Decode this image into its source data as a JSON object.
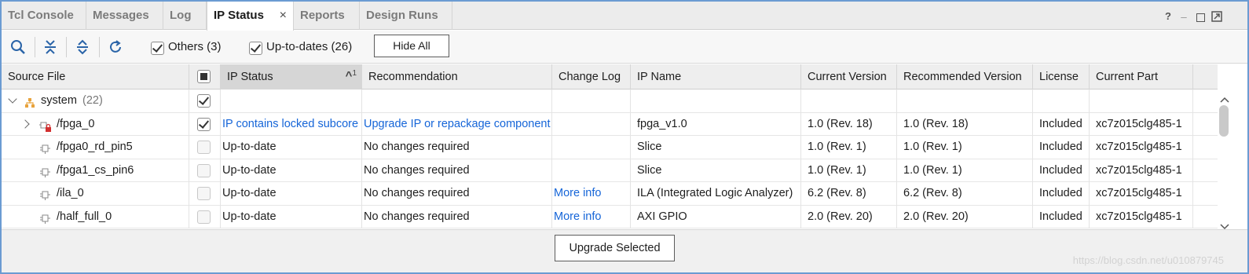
{
  "tabs": [
    {
      "label": "Tcl Console",
      "active": false
    },
    {
      "label": "Messages",
      "active": false
    },
    {
      "label": "Log",
      "active": false
    },
    {
      "label": "IP Status",
      "active": true
    },
    {
      "label": "Reports",
      "active": false
    },
    {
      "label": "Design Runs",
      "active": false
    }
  ],
  "tab_close_glyph": "×",
  "window_controls": {
    "help": "?",
    "minimize": "_"
  },
  "toolbar": {
    "others_label": "Others (3)",
    "others_checked": true,
    "uptodates_label": "Up-to-dates (26)",
    "uptodates_checked": true,
    "hide_all_label": "Hide All",
    "icons": [
      "search-icon",
      "collapse-all-icon",
      "expand-all-icon",
      "refresh-icon"
    ]
  },
  "table": {
    "columns": [
      "Source File",
      "",
      "IP Status",
      "Recommendation",
      "Change Log",
      "IP Name",
      "Current Version",
      "Recommended Version",
      "License",
      "Current Part"
    ],
    "sort_indicator": "^",
    "sort_order": "1",
    "rows": [
      {
        "source": "system",
        "count": "(22)",
        "level": 0,
        "expanded": true,
        "checked": true,
        "disabled": false,
        "icon": "hierarchy-icon",
        "ip_status": "",
        "recommendation": "",
        "change_log": "",
        "ip_name": "",
        "current_version": "",
        "recommended_version": "",
        "license": "",
        "current_part": ""
      },
      {
        "source": "/fpga_0",
        "count": "",
        "level": 1,
        "expandable": true,
        "checked": true,
        "disabled": false,
        "icon": "locked-ip-icon",
        "ip_status": "IP contains locked subcore",
        "ip_status_link": true,
        "recommendation": "Upgrade IP or repackage component",
        "recommendation_link": true,
        "change_log": "",
        "ip_name": "fpga_v1.0",
        "current_version": "1.0 (Rev. 18)",
        "recommended_version": "1.0 (Rev. 18)",
        "license": "Included",
        "current_part": "xc7z015clg485-1"
      },
      {
        "source": "/fpga0_rd_pin5",
        "count": "",
        "level": 1,
        "checked": false,
        "disabled": true,
        "icon": "ip-core-icon",
        "ip_status": "Up-to-date",
        "recommendation": "No changes required",
        "change_log": "",
        "ip_name": "Slice",
        "current_version": "1.0 (Rev. 1)",
        "recommended_version": "1.0 (Rev. 1)",
        "license": "Included",
        "current_part": "xc7z015clg485-1"
      },
      {
        "source": "/fpga1_cs_pin6",
        "count": "",
        "level": 1,
        "checked": false,
        "disabled": true,
        "icon": "ip-core-icon",
        "ip_status": "Up-to-date",
        "recommendation": "No changes required",
        "change_log": "",
        "ip_name": "Slice",
        "current_version": "1.0 (Rev. 1)",
        "recommended_version": "1.0 (Rev. 1)",
        "license": "Included",
        "current_part": "xc7z015clg485-1"
      },
      {
        "source": "/ila_0",
        "count": "",
        "level": 1,
        "checked": false,
        "disabled": true,
        "icon": "ip-core-icon",
        "ip_status": "Up-to-date",
        "recommendation": "No changes required",
        "change_log": "More info",
        "ip_name": "ILA (Integrated Logic Analyzer)",
        "current_version": "6.2 (Rev. 8)",
        "recommended_version": "6.2 (Rev. 8)",
        "license": "Included",
        "current_part": "xc7z015clg485-1"
      },
      {
        "source": "/half_full_0",
        "count": "",
        "level": 1,
        "checked": false,
        "disabled": true,
        "icon": "ip-core-icon",
        "ip_status": "Up-to-date",
        "recommendation": "No changes required",
        "change_log": "More info",
        "ip_name": "AXI GPIO",
        "current_version": "2.0 (Rev. 20)",
        "recommended_version": "2.0 (Rev. 20)",
        "license": "Included",
        "current_part": "xc7z015clg485-1"
      }
    ]
  },
  "footer": {
    "upgrade_label": "Upgrade Selected"
  },
  "watermark": "https://blog.csdn.net/u010879745",
  "colors": {
    "link": "#1565d8",
    "frame": "#6b9bd2",
    "system_icon": "#e8a33c",
    "lock": "#d32f2f"
  }
}
